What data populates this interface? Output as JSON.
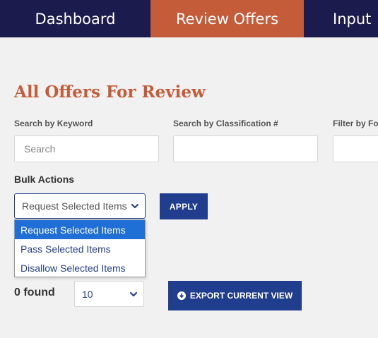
{
  "nav": {
    "tabs": [
      {
        "label": "Dashboard"
      },
      {
        "label": "Review Offers"
      },
      {
        "label": "Input"
      }
    ]
  },
  "page": {
    "title": "All Offers For Review"
  },
  "filters": {
    "keyword_label": "Search by Keyword",
    "keyword_placeholder": "Search",
    "classification_label": "Search by Classification #",
    "filter_label": "Filter by Fo"
  },
  "bulk": {
    "label": "Bulk Actions",
    "selected": "Request Selected Items",
    "options": [
      "Request Selected Items",
      "Pass Selected Items",
      "Disallow Selected Items"
    ],
    "apply_label": "APPLY"
  },
  "results": {
    "found_text": "0 found",
    "per_page": "10",
    "export_label": "EXPORT CURRENT VIEW"
  },
  "icons": {
    "select_chevron": "chevron-down-icon",
    "export": "download-circle-icon"
  },
  "colors": {
    "nav_bg": "#1c1b4d",
    "active_tab": "#c45c3a",
    "title": "#c45c3a",
    "button": "#213d8d",
    "dropdown_highlight": "#1f6fd6"
  }
}
